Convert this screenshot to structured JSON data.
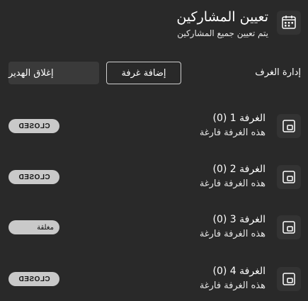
{
  "header": {
    "title": "تعيين المشاركين",
    "subtitle": "يتم تعيين جميع المشاركين",
    "icon": "assign-participants-icon"
  },
  "toolbar": {
    "label": "إدارة الغرف",
    "add_room": "إضافة غرفة",
    "close_lobby": "إغلاق الهدير"
  },
  "rooms": [
    {
      "title": "الغرفة 1 (0)",
      "status": "هذه الغرفة فارغة",
      "badge": "CLOSED"
    },
    {
      "title": "الغرفة 2 (0)",
      "status": "هذه الغرفة فارغة",
      "badge": "CLOSED"
    },
    {
      "title": "الغرفة 3 (0)",
      "status": "هذه الغرفة فارغة",
      "badge": "مغلقة"
    },
    {
      "title": "الغرفة 4 (0)",
      "status": "هذه الغرفة فارغة",
      "badge": "CLOSED"
    }
  ],
  "colors": {
    "background": "#292929",
    "badge": "#c9c9c9",
    "text": "#ffffff"
  }
}
